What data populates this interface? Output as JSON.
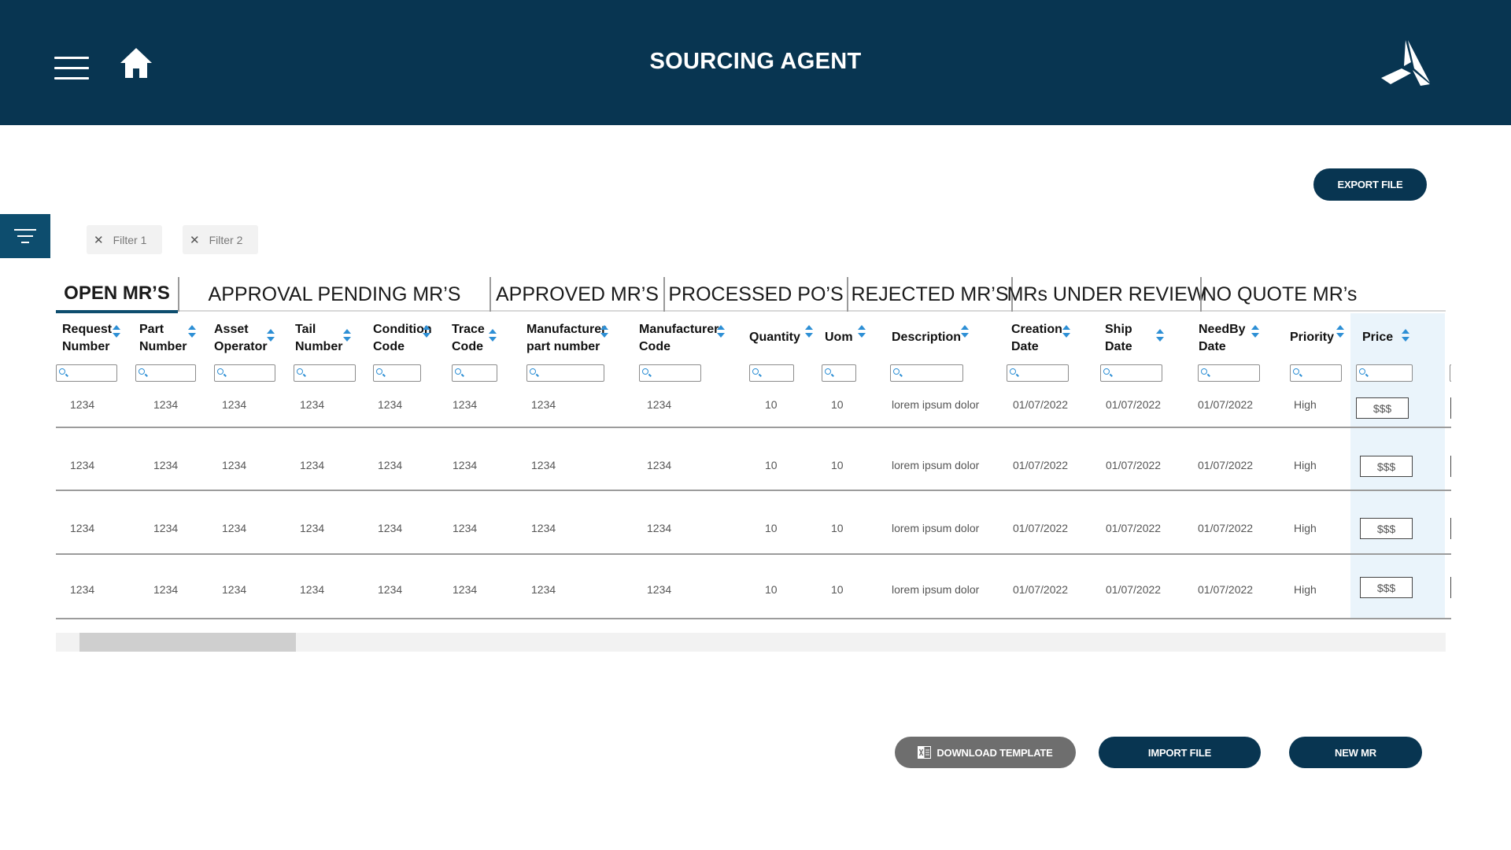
{
  "header": {
    "title": "SOURCING AGENT"
  },
  "actions": {
    "export_label": "EXPORT FILE",
    "download_label": "DOWNLOAD TEMPLATE",
    "import_label": "IMPORT FILE",
    "new_label": "NEW MR"
  },
  "filters": {
    "chips": [
      {
        "label": "Filter 1"
      },
      {
        "label": "Filter 2"
      }
    ]
  },
  "tabs": [
    {
      "label": "OPEN MR’S"
    },
    {
      "label": "APPROVAL PENDING MR’S"
    },
    {
      "label": "APPROVED MR’S"
    },
    {
      "label": "PROCESSED PO’S"
    },
    {
      "label": "REJECTED MR’S"
    },
    {
      "label": "MRs UNDER REVIEW"
    },
    {
      "label": "NO QUOTE MR’s"
    }
  ],
  "table": {
    "columns": [
      {
        "line1": "Request",
        "line2": "Number"
      },
      {
        "line1": "Part",
        "line2": "Number"
      },
      {
        "line1": "Asset",
        "line2": "Operator"
      },
      {
        "line1": "Tail",
        "line2": "Number"
      },
      {
        "line1": "Condition",
        "line2": "Code"
      },
      {
        "line1": "Trace",
        "line2": "Code"
      },
      {
        "line1": "Manufacturer",
        "line2": "part number"
      },
      {
        "line1": "Manufacturer",
        "line2": "Code"
      },
      {
        "line1": "Quantity",
        "line2": ""
      },
      {
        "line1": "Uom",
        "line2": ""
      },
      {
        "line1": "Description",
        "line2": ""
      },
      {
        "line1": "Creation",
        "line2": "Date"
      },
      {
        "line1": "Ship",
        "line2": "Date"
      },
      {
        "line1": "NeedBy",
        "line2": "Date"
      },
      {
        "line1": "Priority",
        "line2": ""
      },
      {
        "line1": "Price",
        "line2": ""
      }
    ],
    "rows": [
      {
        "cells": [
          "1234",
          "1234",
          "1234",
          "1234",
          "1234",
          "1234",
          "1234",
          "1234",
          "10",
          "10",
          "lorem ipsum dolor",
          "01/07/2022",
          "01/07/2022",
          "01/07/2022",
          "High"
        ],
        "price": "$$$"
      },
      {
        "cells": [
          "1234",
          "1234",
          "1234",
          "1234",
          "1234",
          "1234",
          "1234",
          "1234",
          "10",
          "10",
          "lorem ipsum dolor",
          "01/07/2022",
          "01/07/2022",
          "01/07/2022",
          "High"
        ],
        "price": "$$$"
      },
      {
        "cells": [
          "1234",
          "1234",
          "1234",
          "1234",
          "1234",
          "1234",
          "1234",
          "1234",
          "10",
          "10",
          "lorem ipsum dolor",
          "01/07/2022",
          "01/07/2022",
          "01/07/2022",
          "High"
        ],
        "price": "$$$"
      },
      {
        "cells": [
          "1234",
          "1234",
          "1234",
          "1234",
          "1234",
          "1234",
          "1234",
          "1234",
          "10",
          "10",
          "lorem ipsum dolor",
          "01/07/2022",
          "01/07/2022",
          "01/07/2022",
          "High"
        ],
        "price": "$$$"
      }
    ]
  },
  "colors": {
    "header_bg": "#083551",
    "primary_button": "#083551",
    "secondary_button": "#6e6e6e",
    "sort_arrow": "#2d8fd5",
    "price_column_bg": "#eaf4fb"
  },
  "icons": [
    "menu-icon",
    "home-icon",
    "logo-icon",
    "filter-icon",
    "close-icon",
    "sort-icon",
    "search-icon",
    "excel-icon"
  ]
}
